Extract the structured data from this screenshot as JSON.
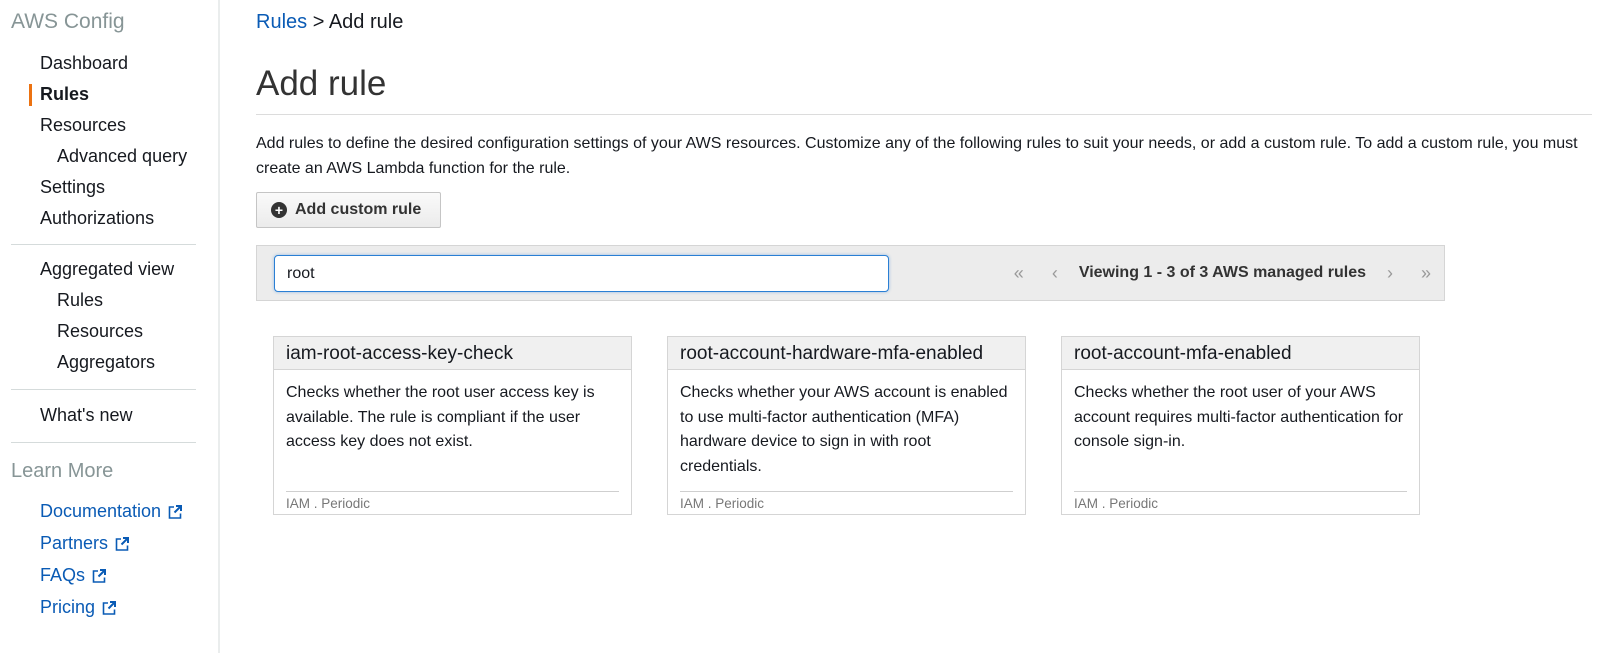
{
  "sidebar": {
    "title": "AWS Config",
    "nav": [
      {
        "label": "Dashboard"
      },
      {
        "label": "Rules",
        "active": true
      },
      {
        "label": "Resources"
      },
      {
        "label": "Advanced query"
      },
      {
        "label": "Settings"
      },
      {
        "label": "Authorizations"
      }
    ],
    "aggregated": [
      {
        "label": "Aggregated view"
      },
      {
        "label": "Rules"
      },
      {
        "label": "Resources"
      },
      {
        "label": "Aggregators"
      }
    ],
    "whats_new": "What's new",
    "learn_more_title": "Learn More",
    "learn_more_links": [
      {
        "label": "Documentation",
        "icon": "external-link-icon"
      },
      {
        "label": "Partners",
        "icon": "external-link-icon"
      },
      {
        "label": "FAQs",
        "icon": "external-link-icon"
      },
      {
        "label": "Pricing",
        "icon": "external-link-icon"
      }
    ],
    "active_color": "#ec7211",
    "link_color": "#0a5bb5"
  },
  "breadcrumb": {
    "parent": "Rules",
    "separator": ">",
    "current": "Add rule"
  },
  "page": {
    "title": "Add rule",
    "description": "Add rules to define the desired configuration settings of your AWS resources. Customize any of the following rules to suit your needs, or add a custom rule. To add a custom rule, you must create an AWS Lambda function for the rule.",
    "add_custom_rule_label": "Add custom rule",
    "add_custom_rule_icon": "plus-circle-icon"
  },
  "filter": {
    "search_value": "root",
    "pager_text": "Viewing 1 - 3 of 3 AWS managed rules",
    "first_icon": "«",
    "prev_icon": "‹",
    "next_icon": "›",
    "last_icon": "»"
  },
  "rules": [
    {
      "name": "iam-root-access-key-check",
      "description": "Checks whether the root user access key is available. The rule is compliant if the user access key does not exist.",
      "meta": "IAM . Periodic"
    },
    {
      "name": "root-account-hardware-mfa-enabled",
      "description": "Checks whether your AWS account is enabled to use multi-factor authentication (MFA) hardware device to sign in with root credentials.",
      "meta": "IAM . Periodic"
    },
    {
      "name": "root-account-mfa-enabled",
      "description": "Checks whether the root user of your AWS account requires multi-factor authentication for console sign-in.",
      "meta": "IAM . Periodic"
    }
  ]
}
